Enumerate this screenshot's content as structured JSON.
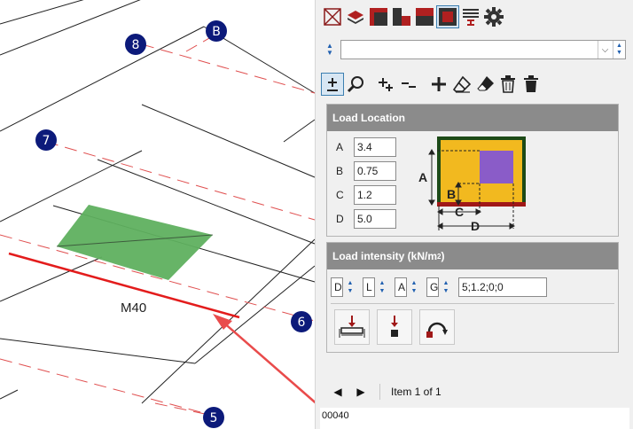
{
  "canvas": {
    "grid_labels": [
      "B",
      "8",
      "7",
      "6",
      "5"
    ],
    "member_label": "M40"
  },
  "toolbar_top": {
    "icons": [
      "delete-view-icon",
      "layers-icon",
      "slab-front-icon",
      "slab-back-icon",
      "slab-dark-icon",
      "slab-selected-icon",
      "beam-section-icon",
      "gear-icon"
    ],
    "active": "slab-selected-icon"
  },
  "selector": {
    "value": ""
  },
  "toolbar_edit": {
    "icons": [
      "plus-minus-icon",
      "magnifier-icon",
      "add-multiple-icon",
      "subtract-icon",
      "add-icon",
      "eraser-icon",
      "eraser-solid-icon",
      "trash-icon",
      "trash-solid-icon"
    ],
    "active": "plus-minus-icon"
  },
  "load_location": {
    "title": "Load Location",
    "rows": [
      {
        "label": "A",
        "value": "3.4"
      },
      {
        "label": "B",
        "value": "0.75"
      },
      {
        "label": "C",
        "value": "1.2"
      },
      {
        "label": "D",
        "value": "5.0"
      }
    ],
    "diagram_labels": {
      "a": "A",
      "b": "B",
      "c": "C",
      "d": "D"
    },
    "colors": {
      "slab": "#f2b91f",
      "load": "#8a5cc8",
      "edge": "#1d4a17",
      "support": "#a01818"
    }
  },
  "load_intensity": {
    "title_main": "Load intensity (kN/m",
    "title_sup": "2",
    "title_end": ")",
    "codes": [
      "D",
      "L",
      "A",
      "G"
    ],
    "value": "5;1.2;0;0",
    "buttons": [
      "distributed-load-icon",
      "point-load-icon",
      "moment-load-icon"
    ]
  },
  "navigation": {
    "prev": "◀",
    "next": "▶",
    "item_text": "Item 1 of 1"
  },
  "status": {
    "text": "00040"
  }
}
